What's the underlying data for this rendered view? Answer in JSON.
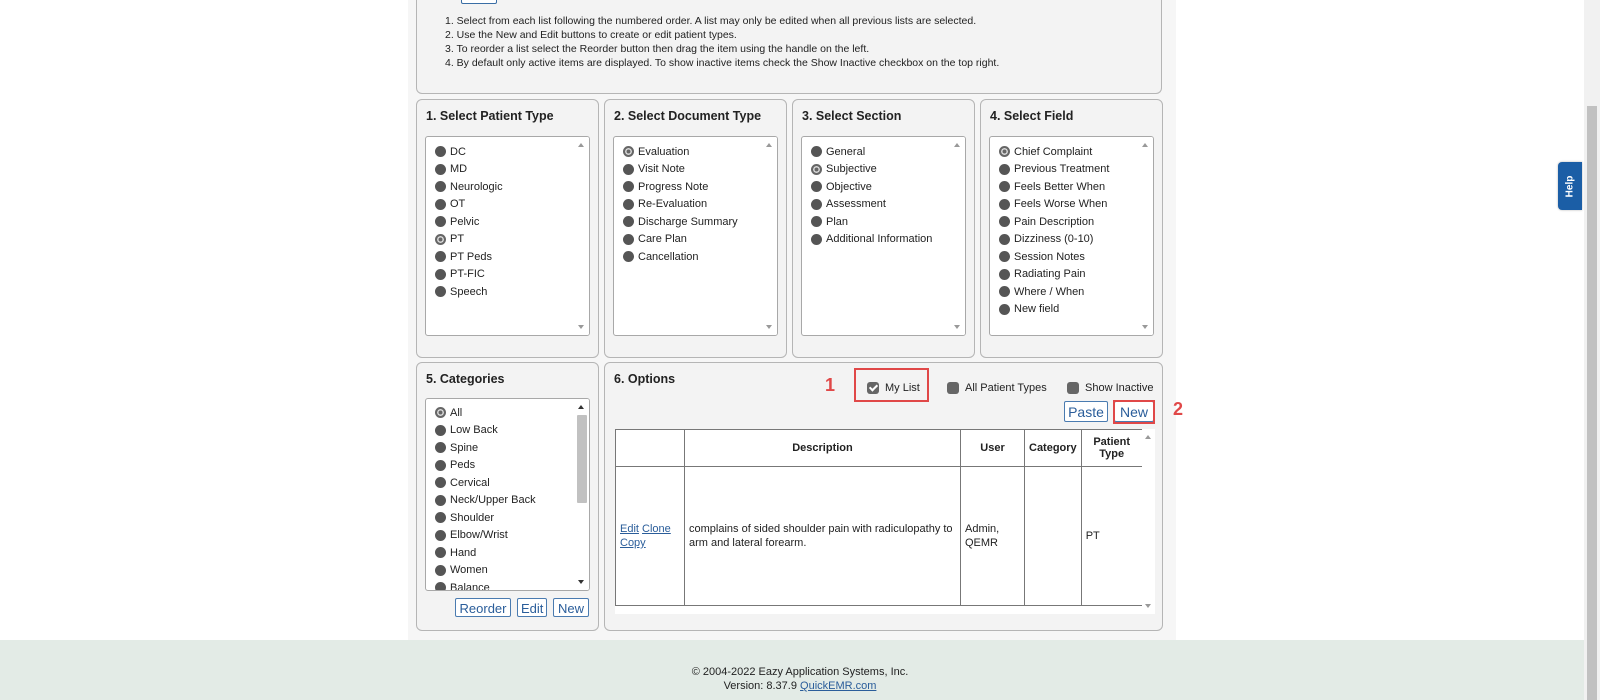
{
  "instructions": [
    "1. Select from each list following the numbered order. A list may only be edited when all previous lists are selected.",
    "2. Use the New and Edit buttons to create or edit patient types.",
    "3. To reorder a list select the Reorder button then drag the item using the handle on the left.",
    "4. By default only active items are displayed. To show inactive items check the Show Inactive checkbox on the top right."
  ],
  "patient_type": {
    "title": "1. Select Patient Type",
    "items": [
      "DC",
      "MD",
      "Neurologic",
      "OT",
      "Pelvic",
      "PT",
      "PT Peds",
      "PT-FIC",
      "Speech"
    ],
    "selected": "PT"
  },
  "document_type": {
    "title": "2. Select Document Type",
    "items": [
      "Evaluation",
      "Visit Note",
      "Progress Note",
      "Re-Evaluation",
      "Discharge Summary",
      "Care Plan",
      "Cancellation"
    ],
    "selected": "Evaluation"
  },
  "section": {
    "title": "3. Select Section",
    "items": [
      "General",
      "Subjective",
      "Objective",
      "Assessment",
      "Plan",
      "Additional Information"
    ],
    "selected": "Subjective"
  },
  "field": {
    "title": "4. Select Field",
    "items": [
      "Chief Complaint",
      "Previous Treatment",
      "Feels Better When",
      "Feels Worse When",
      "Pain Description",
      "Dizziness (0-10)",
      "Session Notes",
      "Radiating Pain",
      "Where / When",
      "New field"
    ],
    "selected": "Chief Complaint"
  },
  "categories": {
    "title": "5. Categories",
    "items": [
      "All",
      "Low Back",
      "Spine",
      "Peds",
      "Cervical",
      "Neck/Upper Back",
      "Shoulder",
      "Elbow/Wrist",
      "Hand",
      "Women",
      "Balance"
    ],
    "selected": "All",
    "buttons": {
      "reorder": "Reorder",
      "edit": "Edit",
      "new": "New"
    }
  },
  "options": {
    "title": "6. Options",
    "my_list_label": "My List",
    "my_list_checked": true,
    "all_patient_types_label": "All Patient Types",
    "show_inactive_label": "Show Inactive",
    "paste_label": "Paste",
    "new_label": "New",
    "table": {
      "headers": {
        "actions": "",
        "description": "Description",
        "user": "User",
        "category": "Category",
        "patient_type": "Patient Type"
      },
      "rows": [
        {
          "edit": "Edit",
          "clone": "Clone",
          "copy": "Copy",
          "description": "complains of sided shoulder pain with radiculopathy to arm and lateral forearm.",
          "user": "Admin, QEMR",
          "category": "",
          "patient_type": "PT"
        }
      ]
    }
  },
  "annotations": {
    "marker_1": "1",
    "marker_2": "2",
    "color": "#e04848"
  },
  "footer": {
    "copyright": "© 2004-2022 Eazy Application Systems, Inc.",
    "version_prefix": "Version: 8.37.9",
    "link": "QuickEMR.com"
  },
  "help_tab": "Help"
}
